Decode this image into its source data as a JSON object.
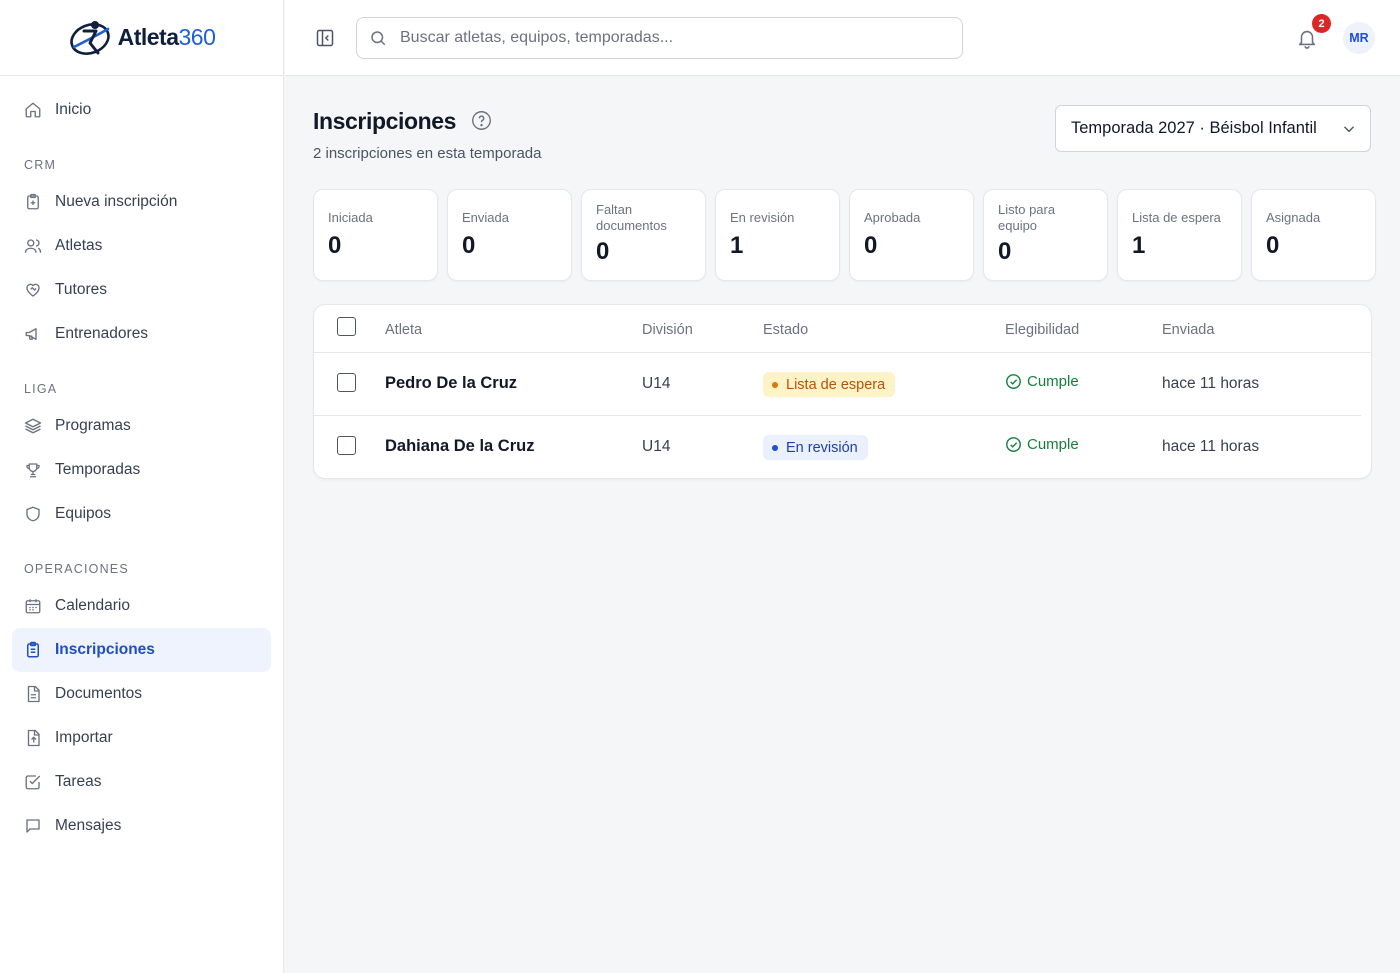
{
  "brand": {
    "name_part": "Atleta",
    "name_number": "360"
  },
  "sidebar": {
    "items": [
      {
        "id": "inicio",
        "label": "Inicio",
        "icon": "home-icon"
      }
    ],
    "sections": [
      {
        "label": "CRM",
        "items": [
          {
            "label": "Nueva inscripción",
            "icon": "clipboard-plus-icon"
          },
          {
            "label": "Atletas",
            "icon": "users-icon"
          },
          {
            "label": "Tutores",
            "icon": "heart-handshake-icon"
          },
          {
            "label": "Entrenadores",
            "icon": "megaphone-icon"
          }
        ]
      },
      {
        "label": "LIGA",
        "items": [
          {
            "label": "Programas",
            "icon": "layers-icon"
          },
          {
            "label": "Temporadas",
            "icon": "trophy-icon"
          },
          {
            "label": "Equipos",
            "icon": "shield-icon"
          }
        ]
      },
      {
        "label": "OPERACIONES",
        "items": [
          {
            "label": "Calendario",
            "icon": "calendar-icon"
          },
          {
            "label": "Inscripciones",
            "icon": "clipboard-list-icon",
            "active": true
          },
          {
            "label": "Documentos",
            "icon": "file-text-icon"
          },
          {
            "label": "Importar",
            "icon": "file-upload-icon"
          },
          {
            "label": "Tareas",
            "icon": "check-square-icon"
          },
          {
            "label": "Mensajes",
            "icon": "message-square-icon"
          }
        ]
      }
    ]
  },
  "topbar": {
    "search_placeholder": "Buscar atletas, equipos, temporadas...",
    "notifications_count": "2",
    "avatar_initials": "MR"
  },
  "page": {
    "title": "Inscripciones",
    "subtitle": "2 inscripciones en esta temporada",
    "season_selected": "Temporada 2027 · Béisbol Infantil"
  },
  "stats": [
    {
      "label": "Iniciada",
      "value": "0"
    },
    {
      "label": "Enviada",
      "value": "0"
    },
    {
      "label": "Faltan documentos",
      "value": "0"
    },
    {
      "label": "En revisión",
      "value": "1"
    },
    {
      "label": "Aprobada",
      "value": "0"
    },
    {
      "label": "Listo para equipo",
      "value": "0"
    },
    {
      "label": "Lista de espera",
      "value": "1"
    },
    {
      "label": "Asignada",
      "value": "0"
    }
  ],
  "table": {
    "columns": [
      "Atleta",
      "División",
      "Estado",
      "Elegibilidad",
      "Enviada"
    ],
    "rows": [
      {
        "athlete": "Pedro De la Cruz",
        "division": "U14",
        "status": "Lista de espera",
        "eligibility": "Cumple",
        "sent": "hace 11 horas"
      },
      {
        "athlete": "Dahiana De la Cruz",
        "division": "U14",
        "status": "En revisión",
        "eligibility": "Cumple",
        "sent": "hace 11 horas"
      }
    ]
  },
  "colors": {
    "accent": "#1f4fbf",
    "badge_waitlist": "#fef3c7",
    "badge_review": "#eaf1fd",
    "eligible_green": "#15803d",
    "notification_red": "#dc2626"
  }
}
